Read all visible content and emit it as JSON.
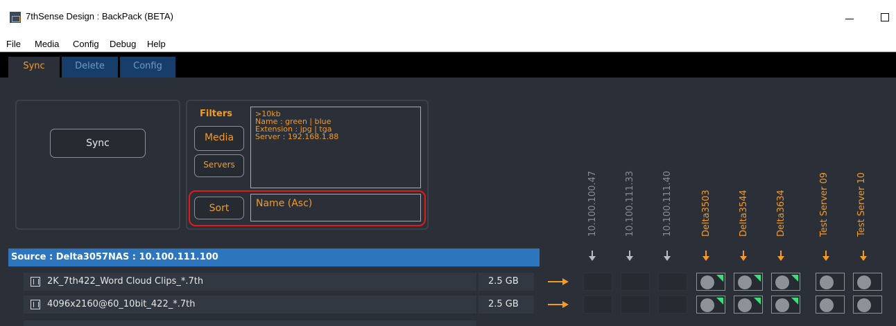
{
  "window": {
    "title": "7thSense Design : BackPack (BETA)"
  },
  "menu": [
    "File",
    "Media",
    "Config",
    "Debug",
    "Help"
  ],
  "tabs": [
    "Sync",
    "Delete",
    "Config"
  ],
  "sync_button": "Sync",
  "filters": {
    "label": "Filters",
    "media_button": "Media",
    "servers_button": "Servers",
    "lines": [
      ">10kb",
      "Name : green | blue",
      "Extension  : jpg | tga",
      "Server : 192.168.1.88"
    ]
  },
  "sort": {
    "button": "Sort",
    "value": "Name (Asc)"
  },
  "servers": [
    {
      "name": "10.100.100.47",
      "color": "#888d94"
    },
    {
      "name": "10.100.111.33",
      "color": "#888d94"
    },
    {
      "name": "10.100.111.40",
      "color": "#888d94"
    },
    {
      "name": "Delta3503",
      "color": "#f59a23"
    },
    {
      "name": "Delta3544",
      "color": "#f59a23"
    },
    {
      "name": "Delta3634",
      "color": "#f59a23"
    },
    {
      "name": "Test Server 09",
      "color": "#f59a23"
    },
    {
      "name": "Test Server 10",
      "color": "#f59a23"
    }
  ],
  "source": "Source : Delta3057NAS : 10.100.111.100",
  "rows": [
    {
      "name": "2K_7th422_Word Cloud Clips_*.7th",
      "size": "2.5 GB"
    },
    {
      "name": "4096x2160@60_10bit_422_*.7th",
      "size": "2.5 GB"
    }
  ],
  "colors": {
    "accent": "#f59a23",
    "source_bar": "#2d76be",
    "status_green": "#3be07a",
    "highlight_outline": "#e21a1a"
  }
}
